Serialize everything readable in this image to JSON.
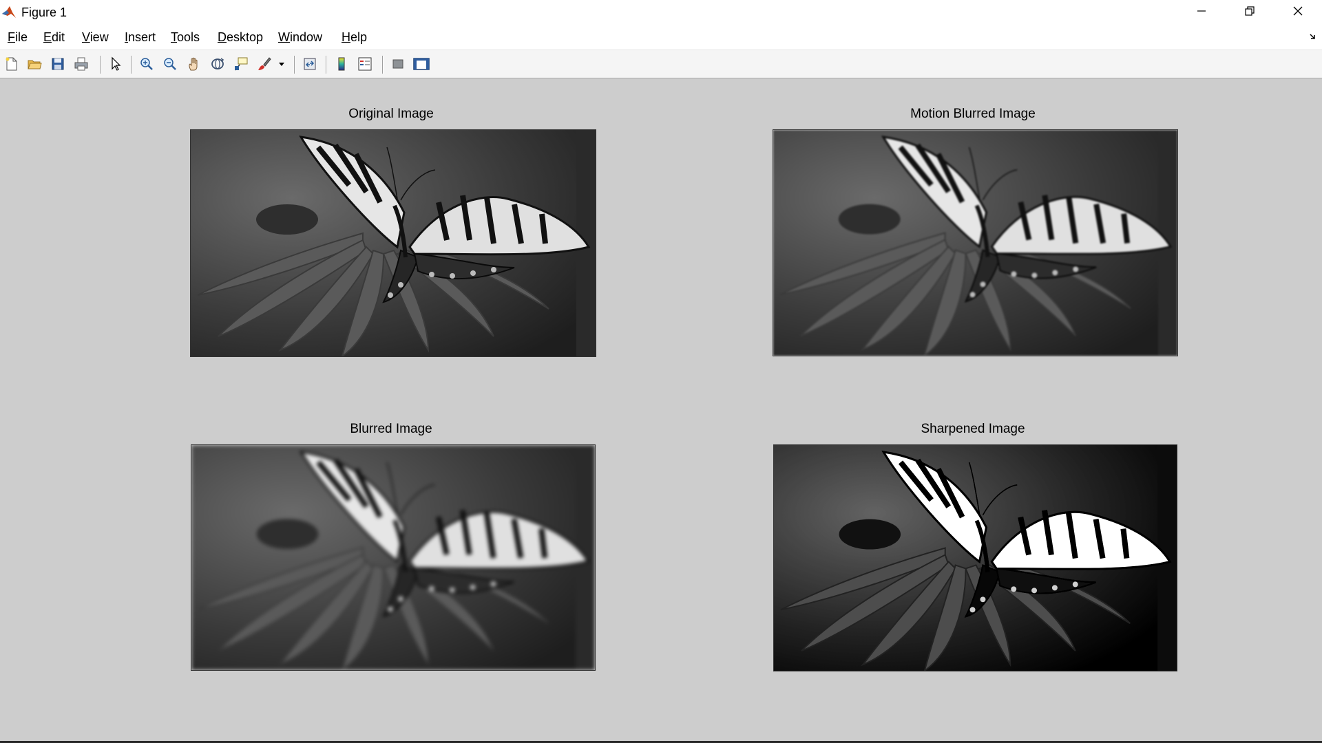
{
  "window": {
    "title": "Figure 1",
    "icon": "matlab-logo-icon",
    "controls": [
      "minimize-icon",
      "restore-icon",
      "close-icon"
    ]
  },
  "menu": {
    "items": [
      {
        "label": "File",
        "mnemonic": "F",
        "rest": "ile"
      },
      {
        "label": "Edit",
        "mnemonic": "E",
        "rest": "dit"
      },
      {
        "label": "View",
        "mnemonic": "V",
        "rest": "iew"
      },
      {
        "label": "Insert",
        "mnemonic": "I",
        "rest": "nsert"
      },
      {
        "label": "Tools",
        "mnemonic": "T",
        "rest": "ools"
      },
      {
        "label": "Desktop",
        "mnemonic": "D",
        "rest": "esktop"
      },
      {
        "label": "Window",
        "mnemonic": "W",
        "rest": "indow"
      },
      {
        "label": "Help",
        "mnemonic": "H",
        "rest": "elp"
      }
    ]
  },
  "toolbar": {
    "buttons": [
      "new-figure-icon",
      "open-file-icon",
      "save-icon",
      "print-icon",
      "edit-plot-icon",
      "zoom-in-icon",
      "zoom-out-icon",
      "pan-icon",
      "rotate-3d-icon",
      "data-cursor-icon",
      "brush-icon",
      "link-plot-icon",
      "colorbar-icon",
      "legend-icon",
      "hide-plot-tools-icon",
      "show-plot-tools-icon"
    ]
  },
  "axes": [
    {
      "title": "Original Image",
      "variant": "original"
    },
    {
      "title": "Motion Blurred Image",
      "variant": "motion"
    },
    {
      "title": "Blurred Image",
      "variant": "blur"
    },
    {
      "title": "Sharpened Image",
      "variant": "sharp"
    }
  ],
  "colors": {
    "figure_bg": "#cdcdcd",
    "toolbar_bg": "#f5f5f5",
    "menubar_bg": "#ffffff"
  }
}
